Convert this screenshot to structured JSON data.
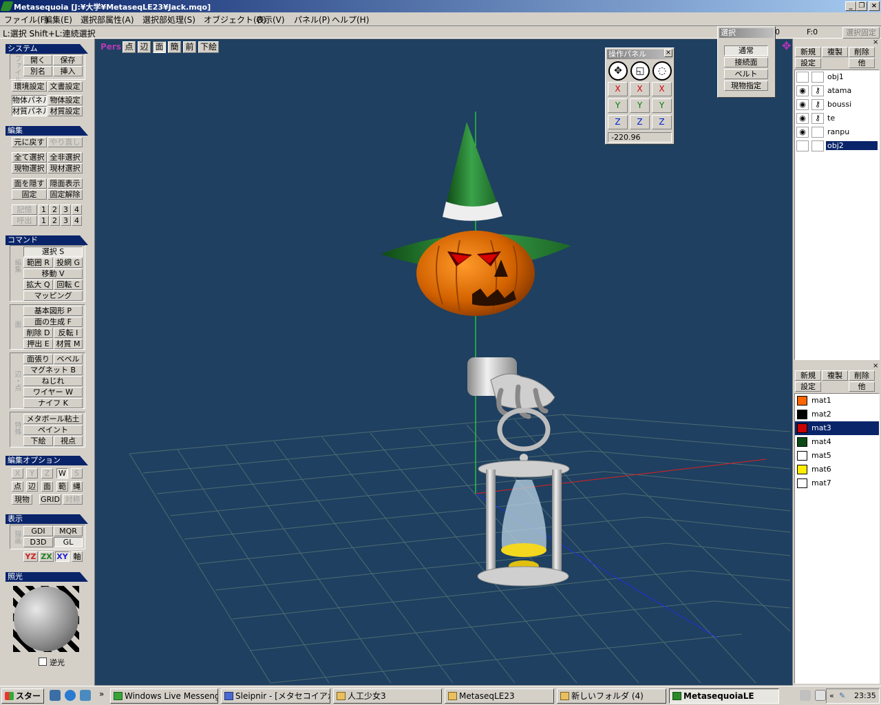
{
  "window": {
    "title": "Metasequoia [J:¥大学¥MetaseqLE23¥Jack.mqo]"
  },
  "menu": [
    "ファイル(F)",
    "編集(E)",
    "選択部属性(A)",
    "選択部処理(S)",
    "オブジェクト(O)",
    "表示(V)",
    "パネル(P)",
    "ヘルプ(H)"
  ],
  "status": {
    "hint": "L:選択  Shift+L:連続選択",
    "zero": "0",
    "fcount": "F:0",
    "lock": "選択固定"
  },
  "left": {
    "system": {
      "title": "システム",
      "file_label": "ファイル",
      "open": "開く",
      "save": "保存",
      "saveas": "別名",
      "insert": "挿入",
      "env": "環境設定",
      "doc": "文書設定",
      "objpanel": "物体パネル",
      "objset": "物体設定",
      "matpanel": "材質パネル",
      "matset": "材質設定"
    },
    "edit": {
      "title": "編集",
      "undo": "元に戻す",
      "redo": "やり直し",
      "selall": "全て選択",
      "deselall": "全非選択",
      "selcur": "現物選択",
      "selmat": "現材選択",
      "hide": "面を隠す",
      "showhide": "隠面表示",
      "fix": "固定",
      "unfix": "固定解除",
      "mem": "記憶",
      "recall": "呼出",
      "n1": "1",
      "n2": "2",
      "n3": "3",
      "n4": "4"
    },
    "command": {
      "title": "コマンド",
      "g1": "編集",
      "select": "選択 S",
      "range": "範囲 R",
      "lasso": "投網 G",
      "move": "移動 V",
      "scale": "拡大 Q",
      "rotate": "回転 C",
      "mapping": "マッピング",
      "g2": "面",
      "prim": "基本図形 P",
      "face": "面の生成 F",
      "del": "削除 D",
      "flip": "反転 I",
      "extrude": "押出 E",
      "material": "材質 M",
      "g3": "辺・点",
      "facecut": "面張り",
      "bevel": "ベベル",
      "magnet": "マグネット B",
      "twist": "ねじれ",
      "wire": "ワイヤー W",
      "knife": "ナイフ K",
      "g4": "特殊",
      "metaball": "メタボール粘土",
      "paint": "ペイント",
      "under": "下絵",
      "view": "視点"
    },
    "editopt": {
      "title": "編集オプション",
      "x": "X",
      "y": "Y",
      "z": "Z",
      "w": "W",
      "s": "S",
      "pt": "点",
      "edge": "辺",
      "face": "面",
      "range": "範",
      "net": "縄",
      "cur": "現物",
      "grid": "GRID",
      "sym": "対称"
    },
    "display": {
      "title": "表示",
      "label": "描画",
      "gdi": "GDI",
      "mqr": "MQR",
      "d3d": "D3D",
      "gl": "GL",
      "yz": "YZ",
      "zx": "ZX",
      "xy": "XY",
      "axis": "軸"
    },
    "light": {
      "title": "照光",
      "backlight": "逆光"
    }
  },
  "viewport": {
    "mode": "Pers",
    "b_pt": "点",
    "b_edge": "辺",
    "b_face": "面",
    "b_simple": "簡",
    "b_front": "前",
    "b_under": "下絵"
  },
  "oppanel": {
    "title": "操作パネル",
    "close": "×",
    "x": "X",
    "y": "Y",
    "z": "Z",
    "value": "-220.96"
  },
  "selpanel": {
    "title": "選択",
    "normal": "通常",
    "connected": "接続面",
    "belt": "ベルト",
    "curobj": "現物指定"
  },
  "objects": {
    "new": "新規",
    "copy": "複製",
    "del": "削除",
    "set": "設定",
    "other": "他",
    "items": [
      {
        "name": "obj1",
        "visible": "",
        "lock": ""
      },
      {
        "name": "atama",
        "visible": "◉",
        "lock": "⚷"
      },
      {
        "name": "boussi",
        "visible": "◉",
        "lock": "⚷"
      },
      {
        "name": "te",
        "visible": "◉",
        "lock": "⚷"
      },
      {
        "name": "ranpu",
        "visible": "◉",
        "lock": ""
      },
      {
        "name": "obj2",
        "visible": "",
        "lock": ""
      }
    ]
  },
  "materials": {
    "new": "新規",
    "copy": "複製",
    "del": "削除",
    "set": "設定",
    "other": "他",
    "items": [
      {
        "name": "mat1",
        "color": "#ff6600"
      },
      {
        "name": "mat2",
        "color": "#000000"
      },
      {
        "name": "mat3",
        "color": "#cc0000"
      },
      {
        "name": "mat4",
        "color": "#0b4a14"
      },
      {
        "name": "mat5",
        "color": "#ffffff"
      },
      {
        "name": "mat6",
        "color": "#ffee00"
      },
      {
        "name": "mat7",
        "color": "#ffffff"
      }
    ]
  },
  "taskbar": {
    "start": "スタート",
    "items": [
      "Windows Live Messenger",
      "Sleipnir - [メタセコイアから...",
      "人工少女3",
      "MetaseqLE23",
      "新しいフォルダ (4)",
      "MetasequoiaLE"
    ],
    "time": "23:35"
  }
}
